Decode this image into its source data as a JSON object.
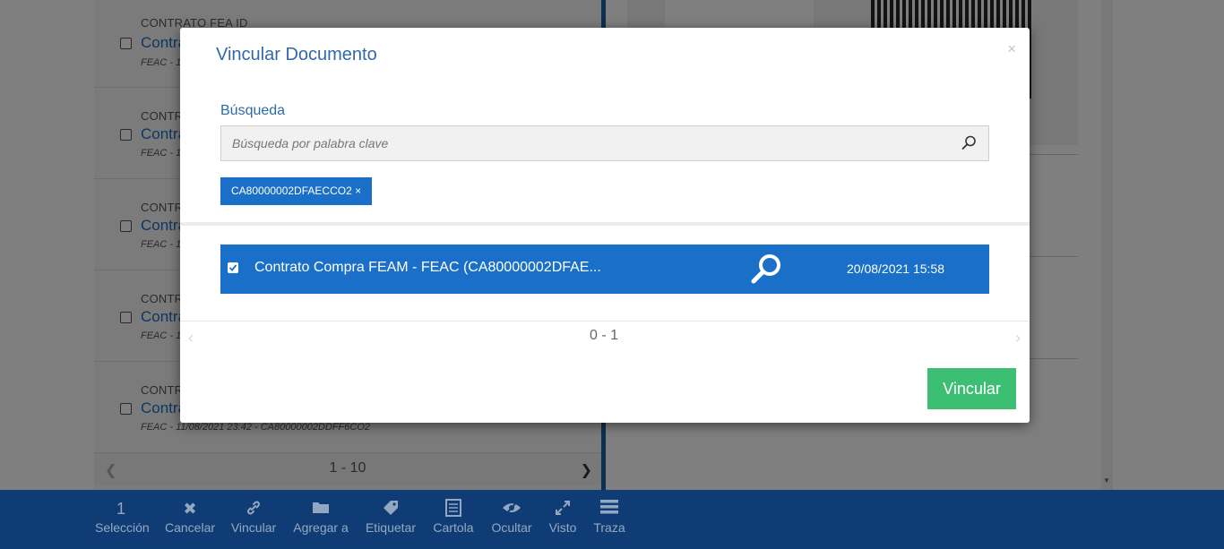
{
  "background": {
    "documents": [
      {
        "type": "CONTRATO FEA ID",
        "title": "Contrato Compra FEAM",
        "subtitle": "FEAC - 19/08/2021 ..."
      },
      {
        "type": "CONTRATO FEA ID",
        "title": "Contrato Compra FEAM",
        "subtitle": "FEAC - 12/08/2021 ..."
      },
      {
        "type": "CONTRATO FEA ID",
        "title": "Contrato Compra FEAM",
        "subtitle": "FEAC - 12/08/2021 ..."
      },
      {
        "type": "CONTRATO FEA ID",
        "title": "Contrato Compra FEAM",
        "subtitle": "FEAC - 12/08/2021 ..."
      },
      {
        "type": "CONTRATO FEA ID",
        "title": "Contrato Compra FEAM",
        "subtitle": "FEAC - 11/08/2021 23:42 - CA80000002DDFF6CO2"
      }
    ],
    "pager_text": "1 - 10"
  },
  "toolbar": {
    "items": [
      {
        "label": "Selección",
        "icon": "count",
        "glyph": "1"
      },
      {
        "label": "Cancelar",
        "icon": "x-icon",
        "glyph": "✖"
      },
      {
        "label": "Vincular",
        "icon": "link-icon",
        "glyph": "🔗"
      },
      {
        "label": "Agregar a",
        "icon": "folder-icon",
        "glyph": "▬"
      },
      {
        "label": "Etiquetar",
        "icon": "tag-icon",
        "glyph": "◆"
      },
      {
        "label": "Cartola",
        "icon": "list-doc-icon",
        "glyph": "▤"
      },
      {
        "label": "Ocultar",
        "icon": "eye-off-icon",
        "glyph": "◉"
      },
      {
        "label": "Visto",
        "icon": "expand-icon",
        "glyph": "⤢"
      },
      {
        "label": "Traza",
        "icon": "list-icon",
        "glyph": "☰"
      }
    ]
  },
  "modal": {
    "title": "Vincular Documento",
    "close": "×",
    "search": {
      "label": "Búsqueda",
      "placeholder": "Búsqueda por palabra clave",
      "value": ""
    },
    "tag": "CA80000002DFAECCO2 ×",
    "result": {
      "title": "Contrato Compra FEAM - FEAC (CA80000002DFAE...",
      "date": "20/08/2021 15:58",
      "checked": true
    },
    "pager": {
      "text": "0 - 1",
      "prev": "‹",
      "next": "›"
    },
    "submit_label": "Vincular"
  },
  "colors": {
    "primary": "#1a6fc9",
    "title_blue": "#2f6aa8",
    "toolbar_bg": "#0f3c74",
    "success": "#3dbf73"
  }
}
